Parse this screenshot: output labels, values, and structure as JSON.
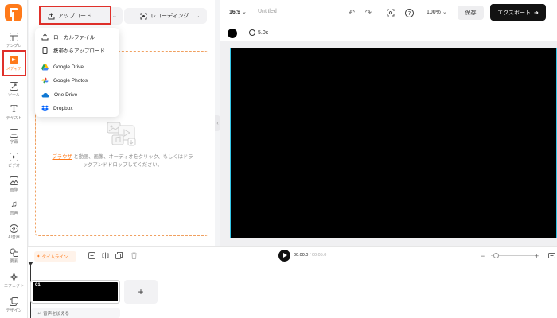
{
  "sidebar": {
    "items": [
      {
        "label": "テンプレ",
        "icon": "template-icon"
      },
      {
        "label": "メディア",
        "icon": "media-icon"
      },
      {
        "label": "ツール",
        "icon": "tools-icon"
      },
      {
        "label": "テキスト",
        "icon": "text-icon"
      },
      {
        "label": "字幕",
        "icon": "subtitles-icon"
      },
      {
        "label": "ビデオ",
        "icon": "video-icon"
      },
      {
        "label": "画像",
        "icon": "image-icon"
      },
      {
        "label": "音声",
        "icon": "audio-icon"
      },
      {
        "label": "AI音声",
        "icon": "ai-voice-icon"
      },
      {
        "label": "要素",
        "icon": "elements-icon"
      },
      {
        "label": "エフェクト",
        "icon": "effects-icon"
      },
      {
        "label": "デザイン",
        "icon": "design-icon"
      }
    ]
  },
  "panel": {
    "upload_label": "アップロード",
    "recording_label": "レコーディング",
    "drop_link": "ブラウザ",
    "drop_text": "と動画、画像、オーディオをクリック、もしくはドラッグアンドドロップしてください。"
  },
  "upload_menu": {
    "items": [
      {
        "label": "ローカルファイル",
        "icon": "upload-icon"
      },
      {
        "label": "携帯からアップロード",
        "icon": "phone-icon"
      },
      {
        "label": "Google Drive",
        "icon": "google-drive-icon"
      },
      {
        "label": "Google Photos",
        "icon": "google-photos-icon"
      },
      {
        "label": "One Drive",
        "icon": "onedrive-icon"
      },
      {
        "label": "Dropbox",
        "icon": "dropbox-icon"
      }
    ]
  },
  "topbar": {
    "aspect": "16:9",
    "title": "Untitled",
    "zoom": "100%",
    "save_label": "保存",
    "export_label": "エクスポート"
  },
  "canvas_toolbar": {
    "duration": "5.0s"
  },
  "timeline": {
    "anim_label": "タイムライン",
    "current_time": "00:00.0",
    "total_time": "/ 00:05.0",
    "clip_number": "01",
    "add_audio_label": "音声を加える"
  },
  "colors": {
    "accent": "#ff7a1a",
    "highlight": "#e0302a",
    "stage_border": "#35c6e8"
  }
}
